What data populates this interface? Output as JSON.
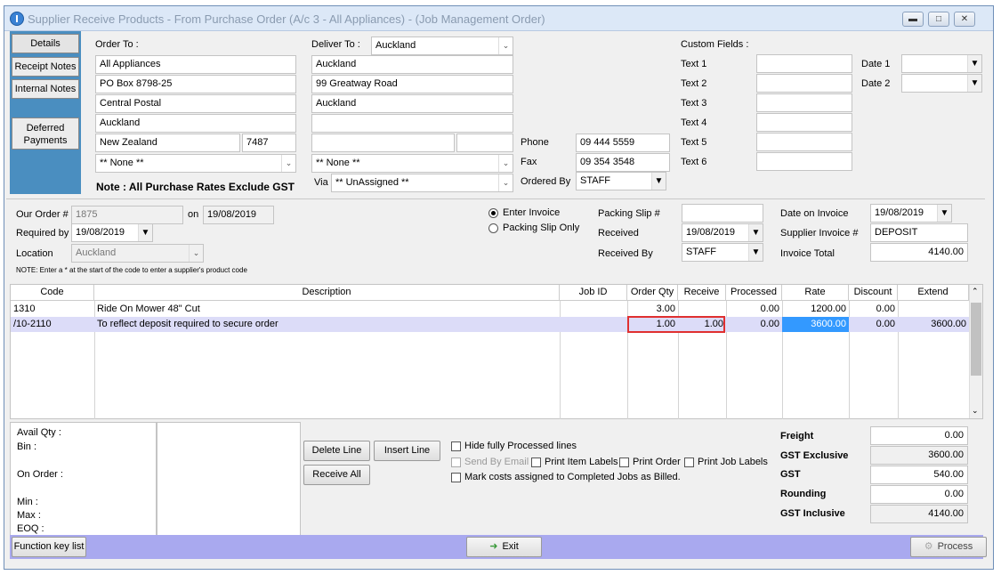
{
  "window": {
    "title": "Supplier Receive Products - From Purchase Order (A/c 3 - All Appliances) - (Job Management Order)"
  },
  "sidebar": {
    "items": [
      {
        "label": "Details"
      },
      {
        "label": "Receipt Notes"
      },
      {
        "label": "Internal Notes"
      },
      {
        "label": "Deferred Payments"
      }
    ]
  },
  "order_to": {
    "label": "Order To :",
    "lines": [
      "All Appliances",
      "PO Box 8798-25",
      "Central Postal",
      "Auckland",
      "New Zealand"
    ],
    "postcode": "7487",
    "select": "** None **",
    "note": "Note : All Purchase Rates Exclude GST"
  },
  "deliver_to": {
    "label": "Deliver To :",
    "selected": "Auckland",
    "lines": [
      "Auckland",
      "99 Greatway Road",
      "Auckland",
      "",
      ""
    ],
    "select": "** None **",
    "via_label": "Via",
    "via": "** UnAssigned **"
  },
  "contact": {
    "phone_label": "Phone",
    "phone": "09 444 5559",
    "fax_label": "Fax",
    "fax": "09 354 3548",
    "ordered_by_label": "Ordered By",
    "ordered_by": "STAFF"
  },
  "custom_fields": {
    "label": "Custom Fields :",
    "texts": [
      "Text 1",
      "Text 2",
      "Text 3",
      "Text 4",
      "Text 5",
      "Text 6"
    ],
    "date1_label": "Date 1",
    "date2_label": "Date 2"
  },
  "order_info": {
    "our_order_label": "Our Order #",
    "our_order": "1875",
    "on_label": "on",
    "on_date": "19/08/2019",
    "required_by_label": "Required by",
    "required_by": "19/08/2019",
    "location_label": "Location",
    "location": "Auckland",
    "note": "NOTE: Enter a * at the start of the code to enter a supplier's product code"
  },
  "mode": {
    "enter_invoice": "Enter Invoice",
    "packing_slip_only": "Packing Slip Only",
    "selected": "enter_invoice"
  },
  "receipt": {
    "packing_slip_label": "Packing Slip #",
    "packing_slip": "",
    "received_label": "Received",
    "received": "19/08/2019",
    "received_by_label": "Received By",
    "received_by": "STAFF"
  },
  "invoice": {
    "date_label": "Date on Invoice",
    "date": "19/08/2019",
    "supplier_invoice_label": "Supplier Invoice #",
    "supplier_invoice": "DEPOSIT",
    "total_label": "Invoice Total",
    "total": "4140.00"
  },
  "grid": {
    "columns": [
      "Code",
      "Description",
      "Job ID",
      "Order Qty",
      "Receive",
      "Processed",
      "Rate",
      "Discount",
      "Extend"
    ],
    "rows": [
      {
        "code": "1310",
        "description": "Ride On Mower 48\" Cut",
        "job_id": "",
        "order_qty": "3.00",
        "receive": "",
        "processed": "0.00",
        "rate": "1200.00",
        "discount": "0.00",
        "extend": ""
      },
      {
        "code": "/10-2110",
        "description": "To reflect deposit required to secure order",
        "job_id": "",
        "order_qty": "1.00",
        "receive": "1.00",
        "processed": "0.00",
        "rate": "3600.00",
        "discount": "0.00",
        "extend": "3600.00"
      }
    ]
  },
  "stock": {
    "avail_qty": "Avail Qty :",
    "bin": "Bin :",
    "on_order": "On Order :",
    "min": "Min :",
    "max": "Max :",
    "eoq": "EOQ :"
  },
  "actions": {
    "delete_line": "Delete Line",
    "insert_line": "Insert Line",
    "receive_all": "Receive All",
    "hide_processed": "Hide fully Processed lines",
    "send_by_email": "Send By Email",
    "print_item_labels": "Print Item Labels",
    "print_order": "Print Order",
    "print_job_labels": "Print Job Labels",
    "mark_costs": "Mark costs assigned to Completed Jobs as Billed."
  },
  "totals": [
    {
      "label": "Freight",
      "value": "0.00"
    },
    {
      "label": "GST Exclusive",
      "value": "3600.00"
    },
    {
      "label": "GST",
      "value": "540.00"
    },
    {
      "label": "Rounding",
      "value": "0.00"
    },
    {
      "label": "GST Inclusive",
      "value": "4140.00"
    }
  ],
  "footer": {
    "function_keys": "Function key list",
    "exit": "Exit",
    "process": "Process"
  },
  "colors": {
    "sidebar": "#4a8ec0",
    "footer": "#a9a9ef",
    "selected_row": "#dcdcf8",
    "highlight_cell": "#3399ff",
    "edit_border": "#e03030"
  },
  "icons": [
    "app-icon",
    "minimize-icon",
    "restore-icon",
    "close-icon",
    "exit-icon",
    "process-icon",
    "chevron-down-icon",
    "scroll-up-icon",
    "scroll-down-icon"
  ]
}
